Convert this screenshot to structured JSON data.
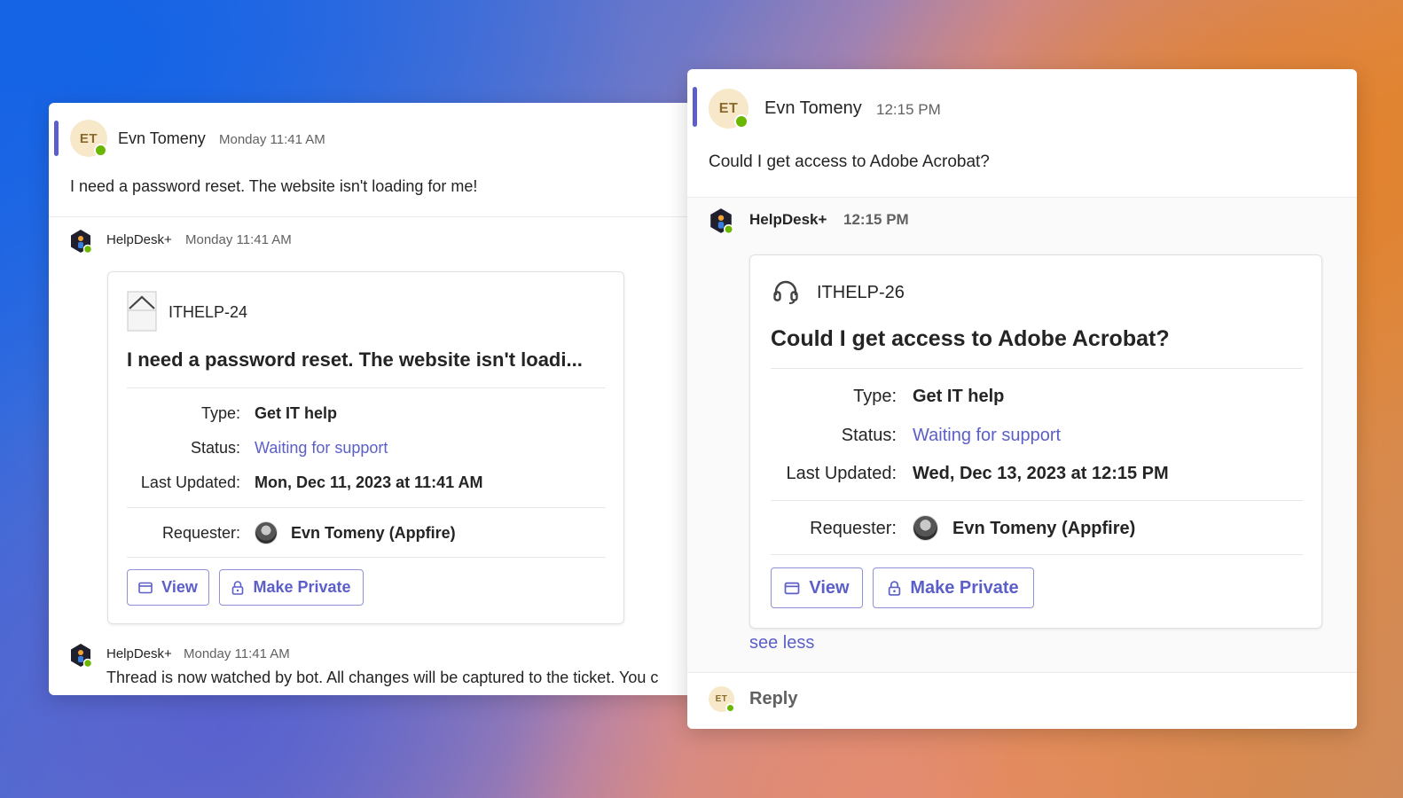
{
  "left": {
    "message": {
      "avatar_initials": "ET",
      "author": "Evn Tomeny",
      "time": "Monday 11:41 AM",
      "text": "I need a password reset. The website isn't loading for me!"
    },
    "bot_reply": {
      "author": "HelpDesk+",
      "time": "Monday 11:41 AM",
      "card": {
        "ticket_key": "ITHELP-24",
        "summary": "I need a password reset. The website isn't loadi...",
        "type_label": "Type:",
        "type_value": "Get IT help",
        "status_label": "Status:",
        "status_value": "Waiting for support",
        "updated_label": "Last Updated:",
        "updated_value": "Mon, Dec 11, 2023 at 11:41 AM",
        "requester_label": "Requester:",
        "requester_value": "Evn Tomeny (Appfire)",
        "view_label": "View",
        "private_label": "Make Private"
      }
    },
    "bot_followup": {
      "author": "HelpDesk+",
      "time": "Monday 11:41 AM",
      "text": "Thread is now watched by bot. All changes will be captured to the ticket. You c"
    }
  },
  "right": {
    "message": {
      "avatar_initials": "ET",
      "author": "Evn Tomeny",
      "time": "12:15 PM",
      "text": "Could I get access to Adobe Acrobat?"
    },
    "bot_reply": {
      "author": "HelpDesk+",
      "time": "12:15 PM",
      "card": {
        "ticket_key": "ITHELP-26",
        "summary": "Could I get access to Adobe Acrobat?",
        "type_label": "Type:",
        "type_value": "Get IT help",
        "status_label": "Status:",
        "status_value": "Waiting for support",
        "updated_label": "Last Updated:",
        "updated_value": "Wed, Dec 13, 2023 at 12:15 PM",
        "requester_label": "Requester:",
        "requester_value": "Evn Tomeny (Appfire)",
        "view_label": "View",
        "private_label": "Make Private"
      },
      "see_less": "see less"
    },
    "reply": {
      "avatar_initials": "ET",
      "label": "Reply"
    }
  },
  "colors": {
    "accent": "#5b5fc7",
    "presence": "#6bb700",
    "avatar_bg": "#f6e8c8"
  },
  "icons": {
    "ticket_left": "ticket-placeholder-icon",
    "ticket_right": "headset-icon",
    "view": "window-icon",
    "private": "lock-icon",
    "bot": "helpdesk-bot-icon"
  }
}
